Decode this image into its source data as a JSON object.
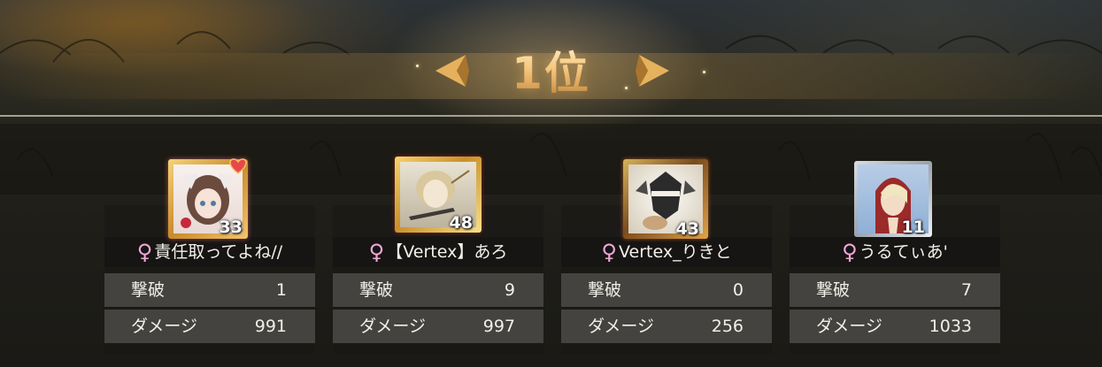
{
  "result": {
    "rank_label": "1位"
  },
  "stat_labels": {
    "kills": "撃破",
    "damage": "ダメージ"
  },
  "players": [
    {
      "name": "責任取ってよね//",
      "gender_symbol": "♀",
      "level": "33",
      "kills": "1",
      "damage": "991"
    },
    {
      "name": "【Vertex】あろ",
      "gender_symbol": "♀",
      "level": "48",
      "kills": "9",
      "damage": "997"
    },
    {
      "name": "Vertex_りきと",
      "gender_symbol": "♀",
      "level": "43",
      "kills": "0",
      "damage": "256"
    },
    {
      "name": "うるてぃあ'",
      "gender_symbol": "♀",
      "level": "11",
      "kills": "7",
      "damage": "1033"
    }
  ],
  "colors": {
    "gold_accent": "#e8b66c",
    "gender_pink": "#f2a6d8",
    "stat_row_bg": "#5f5e5a",
    "text_light": "#f2efe8"
  }
}
